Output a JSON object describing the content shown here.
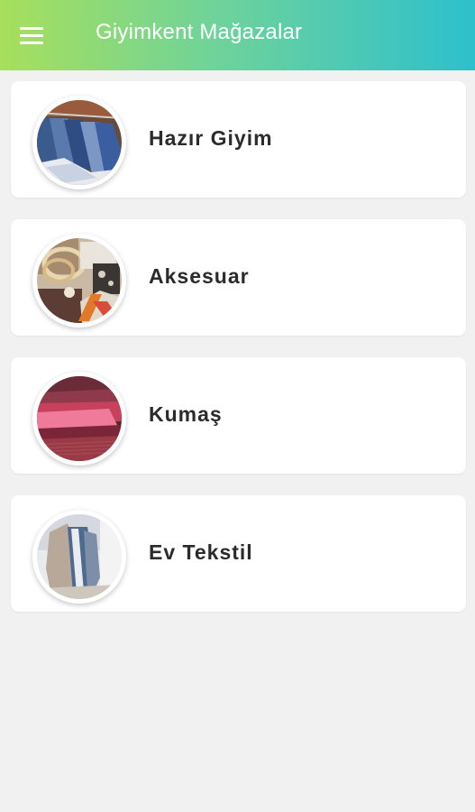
{
  "app": {
    "title": "Giyimkent Mağazalar",
    "menu_icon": "hamburger-menu-icon",
    "gradient": [
      "#a8df5c",
      "#2dc0cd"
    ]
  },
  "categories": [
    {
      "label": "Hazır Giyim",
      "image": "clothes-rack-photo"
    },
    {
      "label": "Aksesuar",
      "image": "accessories-photo"
    },
    {
      "label": "Kumaş",
      "image": "fabric-rolls-photo"
    },
    {
      "label": "Ev Tekstil",
      "image": "home-textile-photo"
    }
  ]
}
